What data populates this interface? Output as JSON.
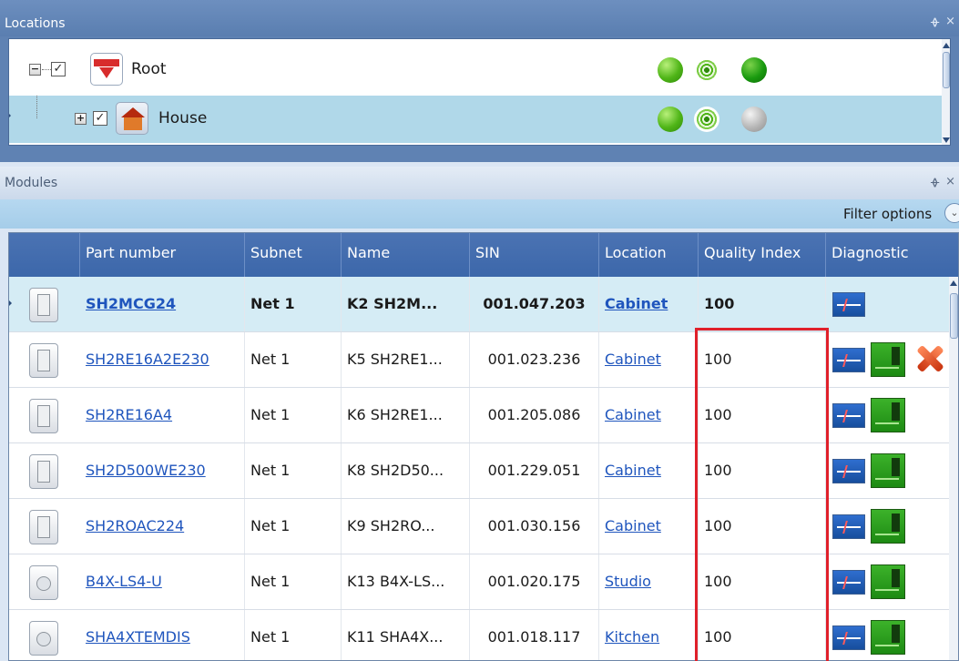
{
  "locations": {
    "title": "Locations",
    "pin": "ᚖ",
    "close": "×",
    "items": [
      {
        "toggle": "−",
        "checked": "✓",
        "label": "Root",
        "statuses": [
          "green",
          "signal",
          "dark-green"
        ]
      },
      {
        "toggle": "+",
        "checked": "✓",
        "label": "House",
        "statuses": [
          "green",
          "signal",
          "grey"
        ]
      }
    ]
  },
  "modules": {
    "title": "Modules",
    "pin": "ᚖ",
    "close": "×",
    "filter_label": "Filter options",
    "filter_icon": "chevron-down-icon",
    "columns": [
      "",
      "Part number",
      "Subnet",
      "Name",
      "SIN",
      "Location",
      "Quality Index",
      "Diagnostic"
    ],
    "rows": [
      {
        "part": "SH2MCG24",
        "subnet": "Net 1",
        "name": "K2 SH2M...",
        "sin": "001.047.203",
        "location": "Cabinet",
        "quality": "100",
        "diagnostics": [
          "monitor-icon"
        ]
      },
      {
        "part": "SH2RE16A2E230",
        "subnet": "Net 1",
        "name": "K5 SH2RE1...",
        "sin": "001.023.236",
        "location": "Cabinet",
        "quality": "100",
        "diagnostics": [
          "monitor-icon",
          "board-icon",
          "alarm-icon"
        ]
      },
      {
        "part": "SH2RE16A4",
        "subnet": "Net 1",
        "name": "K6 SH2RE1...",
        "sin": "001.205.086",
        "location": "Cabinet",
        "quality": "100",
        "diagnostics": [
          "monitor-icon",
          "board-icon"
        ]
      },
      {
        "part": "SH2D500WE230",
        "subnet": "Net 1",
        "name": "K8 SH2D50...",
        "sin": "001.229.051",
        "location": "Cabinet",
        "quality": "100",
        "diagnostics": [
          "monitor-icon",
          "board-icon"
        ]
      },
      {
        "part": "SH2ROAC224",
        "subnet": "Net 1",
        "name": "K9 SH2RO...",
        "sin": "001.030.156",
        "location": "Cabinet",
        "quality": "100",
        "diagnostics": [
          "monitor-icon",
          "board-icon"
        ]
      },
      {
        "part": "B4X-LS4-U",
        "subnet": "Net 1",
        "name": "K13 B4X-LS...",
        "sin": "001.020.175",
        "location": "Studio",
        "quality": "100",
        "diagnostics": [
          "monitor-icon",
          "board-icon"
        ]
      },
      {
        "part": "SHA4XTEMDIS",
        "subnet": "Net 1",
        "name": "K11 SHA4X...",
        "sin": "001.018.117",
        "location": "Kitchen",
        "quality": "100",
        "diagnostics": [
          "monitor-icon",
          "board-icon"
        ]
      }
    ]
  },
  "colors": {
    "header_blue": "#3c67aa",
    "selected_row": "#d5ecf5",
    "link": "#1f55bd",
    "highlight": "#e0202a"
  }
}
